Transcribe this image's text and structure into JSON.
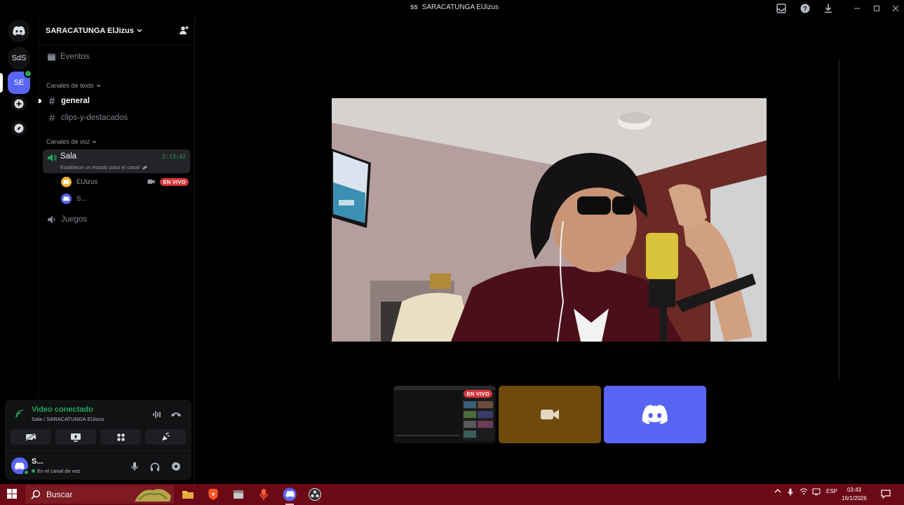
{
  "window": {
    "title_prefix": "SS",
    "title": "SARACATUNGA ElJizus"
  },
  "rail": {
    "servers": [
      {
        "label": "SdS"
      },
      {
        "label": "SE",
        "active": true
      }
    ]
  },
  "sidebar": {
    "server_name": "SARACATUNGA ElJizus",
    "events_label": "Eventos",
    "text_category": "Canales de texto",
    "text_channels": [
      {
        "name": "general",
        "selected": true
      },
      {
        "name": "clips-y-destacados"
      }
    ],
    "voice_category": "Canales de voz",
    "voice_channel": {
      "name": "Sala",
      "timer": "2:13:42",
      "status_hint": "Establece un estado para el canal"
    },
    "members": [
      {
        "name": "ElJizus",
        "live": "EN VIVO",
        "avatar_color": "#f0b232"
      },
      {
        "name": "S...",
        "avatar_color": "#5865f2"
      }
    ],
    "other_voice": "Juegos"
  },
  "voice_panel": {
    "title": "Video conectado",
    "subtitle": "Sala / SARACATUNGA ElJizus"
  },
  "user_panel": {
    "name": "S...",
    "status": "En el canal de voz"
  },
  "stage": {
    "thumb_live": "EN VIVO",
    "thumb_camera_color": "#6e4a0c",
    "thumb_discord_color": "#5865f2"
  },
  "taskbar": {
    "search_placeholder": "Buscar",
    "tray_lang": "ESP",
    "time": "03:43",
    "date": "16/1/2026",
    "color": "#6b0a16"
  }
}
